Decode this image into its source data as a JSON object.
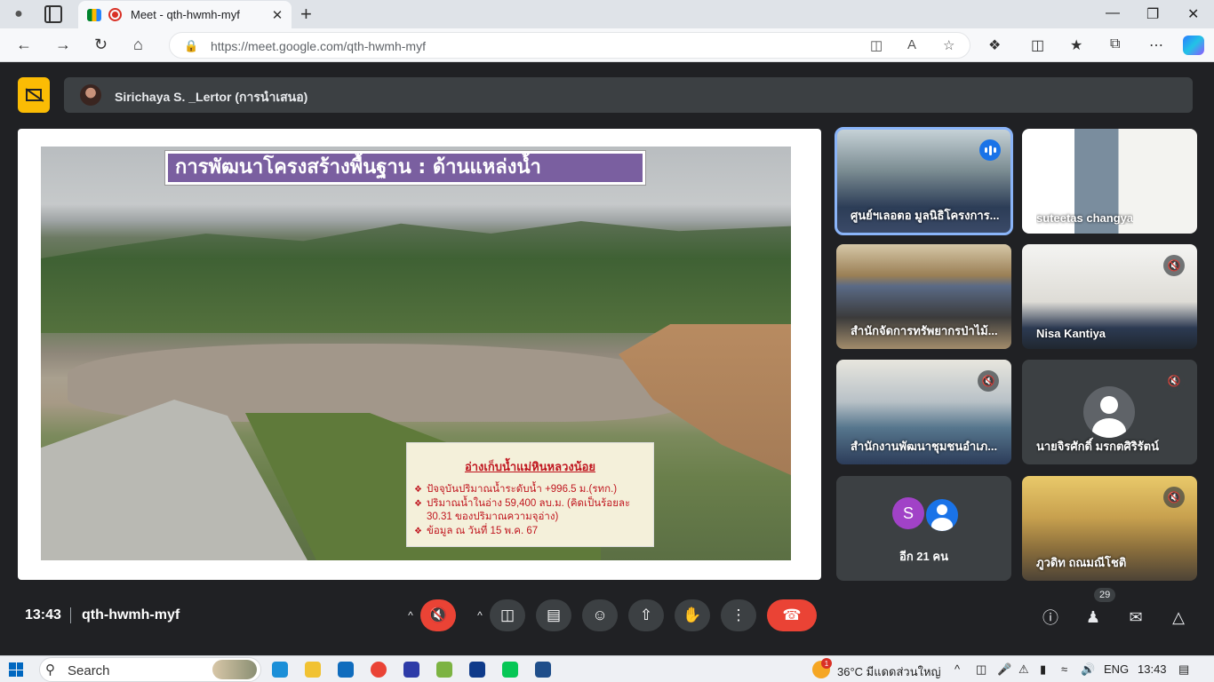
{
  "browser": {
    "tab_title": "Meet - qth-hwmh-myf",
    "url": "https://meet.google.com/qth-hwmh-myf",
    "window_controls": [
      "minimize-icon",
      "maximize-icon",
      "close-icon"
    ]
  },
  "meet": {
    "presenter": "Sirichaya S. _Lertor (การนำเสนอ)",
    "slide": {
      "title": "การพัฒนาโครงสร้างพื้นฐาน :  ด้านแหล่งน้ำ",
      "box_heading": "อ่างเก็บน้ำแม่หินหลวงน้อย",
      "bullets": [
        "ปัจจุบันปริมาณน้ำระดับน้ำ +996.5 ม.(รทก.)",
        "ปริมาณน้ำในอ่าง  59,400 ลบ.ม. (คิดเป็นร้อยละ 30.31  ของปริมาณความจุอ่าง)",
        "ข้อมูล ณ  วันที่  15 พ.ค. 67"
      ]
    },
    "participants": [
      {
        "name": "ศูนย์ฯเลอตอ มูลนิธิโครงการ...",
        "muted": false,
        "speaking": true
      },
      {
        "name": "suteetas changya",
        "muted": false,
        "speaking": false
      },
      {
        "name": "สำนักจัดการทรัพยากรป่าไม้...",
        "muted": false,
        "speaking": false
      },
      {
        "name": "Nisa Kantiya",
        "muted": true,
        "speaking": false
      },
      {
        "name": "สำนักงานพัฒนาชุมชนอำเภ...",
        "muted": true,
        "speaking": false
      },
      {
        "name": "นายจิรศักดิ์ มรกตศิริรัตน์",
        "muted": true,
        "speaking": false
      },
      {
        "name": "ภูวดิท ถณมณีโชติ",
        "muted": true,
        "speaking": false
      }
    ],
    "others": {
      "label": "อีก 21 คน",
      "initial": "S"
    },
    "time": "13:43",
    "meeting_code": "qth-hwmh-myf",
    "people_count": "29"
  },
  "taskbar": {
    "search": "Search",
    "weather": "36°C  มีแดดส่วนใหญ่",
    "weather_badge": "1",
    "lang": "ENG",
    "clock": "13:43"
  }
}
